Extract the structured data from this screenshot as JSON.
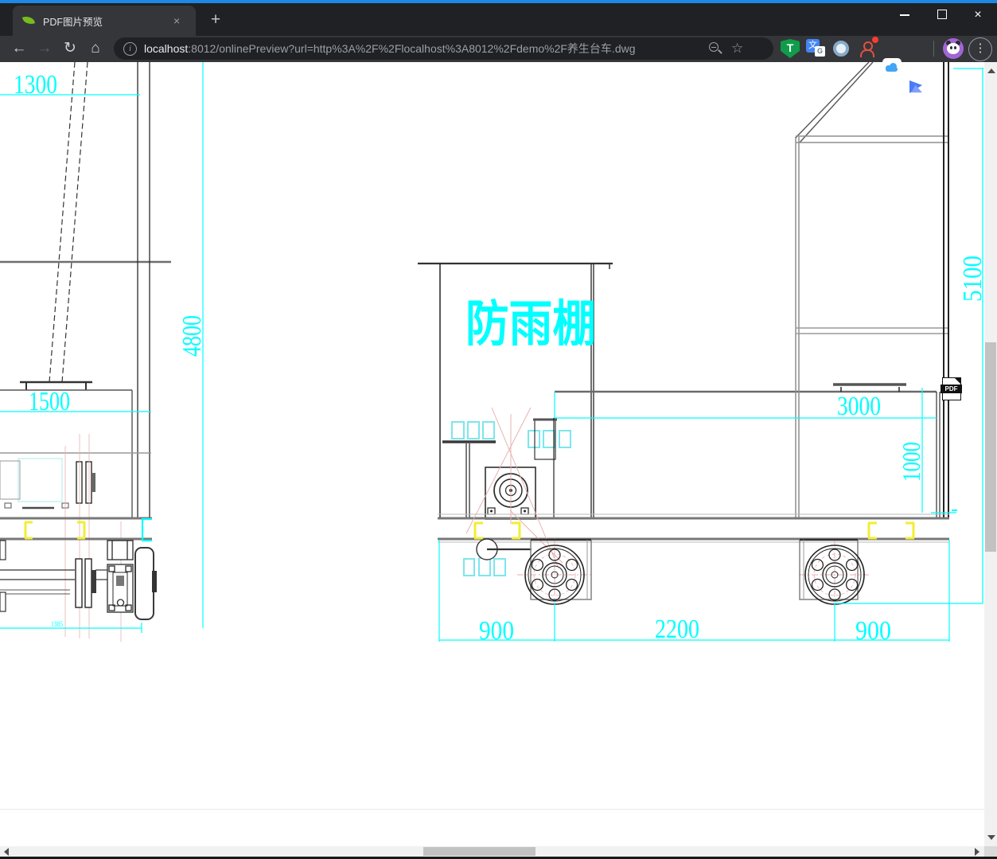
{
  "window": {
    "accent_color": "#1e88e5",
    "controls": {
      "minimize": "minimize",
      "maximize": "maximize",
      "close_glyph": "×"
    }
  },
  "browser": {
    "tab_title": "PDF图片预览",
    "favicon": "spring-leaf-icon",
    "close_tab_glyph": "×",
    "new_tab_glyph": "+",
    "nav": {
      "back_glyph": "←",
      "forward_glyph": "→",
      "reload_glyph": "↻",
      "home_glyph": "⌂"
    },
    "address": {
      "info_glyph": "i",
      "host": "localhost",
      "rest": ":8012/onlinePreview?url=http%3A%2F%2Flocalhost%3A8012%2Fdemo%2F养生台车.dwg",
      "bookmark_glyph": "☆"
    },
    "extensions": [
      "tampermonkey",
      "google-translate",
      "sphere",
      "red-contact",
      "cloud",
      "kite"
    ],
    "extension_glyphs": {
      "tampermonkey": "T",
      "translate_cn": "文",
      "translate_g": "G"
    },
    "menu_glyph": "⋮"
  },
  "drawing": {
    "shelter_label": "防雨棚",
    "dims": {
      "top_width": "1300",
      "left_height": "4800",
      "tank_width": "1500",
      "axle_span": "1385",
      "overall_height": "5100",
      "body_width": "3000",
      "body_height": "1000",
      "front_overhang": "900",
      "wheelbase": "2200",
      "rear_overhang": "900"
    },
    "colors": {
      "dimension": "#00ffff",
      "clamp": "#f2ee34",
      "centerline": "#e8abab"
    }
  },
  "pdf_badge": "PDF"
}
